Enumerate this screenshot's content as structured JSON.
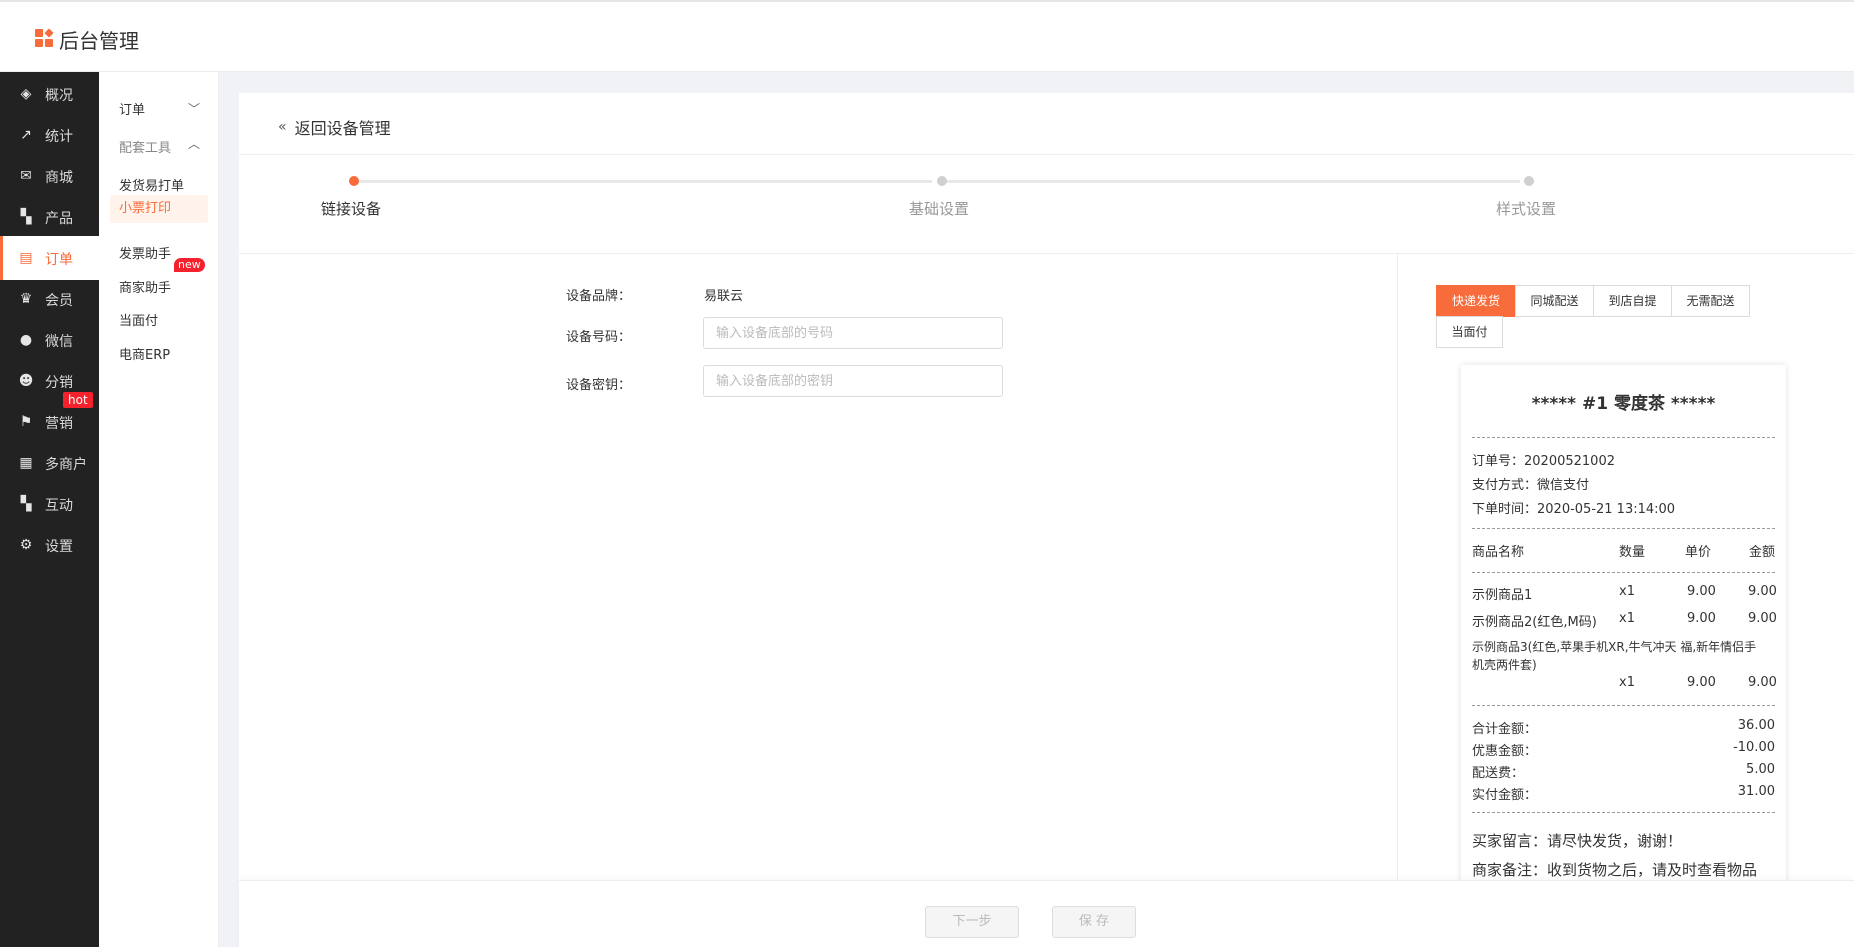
{
  "header": {
    "title": "后台管理"
  },
  "sidebar": {
    "items": [
      {
        "label": "概况",
        "icon": "layers-icon"
      },
      {
        "label": "统计",
        "icon": "chart-icon"
      },
      {
        "label": "商城",
        "icon": "mail-icon"
      },
      {
        "label": "产品",
        "icon": "grid-icon"
      },
      {
        "label": "订单",
        "icon": "clipboard-icon",
        "active": true
      },
      {
        "label": "会员",
        "icon": "crown-icon"
      },
      {
        "label": "微信",
        "icon": "wechat-icon"
      },
      {
        "label": "分销",
        "icon": "user-share-icon"
      },
      {
        "label": "营销",
        "icon": "flag-icon",
        "badge": "hot"
      },
      {
        "label": "多商户",
        "icon": "store-icon"
      },
      {
        "label": "互动",
        "icon": "people-icon"
      },
      {
        "label": "设置",
        "icon": "gear-icon"
      }
    ]
  },
  "subnav": {
    "groups": [
      {
        "label": "订单",
        "chevron": "down"
      },
      {
        "label": "配套工具",
        "chevron": "up"
      }
    ],
    "items": [
      {
        "label": "发货易打单"
      },
      {
        "label": "小票打印",
        "active": true
      },
      {
        "label": "发票助手",
        "badge": "new"
      },
      {
        "label": "商家助手"
      },
      {
        "label": "当面付"
      },
      {
        "label": "电商ERP"
      }
    ]
  },
  "page": {
    "back_label": "返回设备管理",
    "steps": [
      {
        "label": "链接设备",
        "active": true
      },
      {
        "label": "基础设置",
        "active": false
      },
      {
        "label": "样式设置",
        "active": false
      }
    ],
    "form": {
      "brand_label": "设备品牌：",
      "brand_value": "易联云",
      "number_label": "设备号码：",
      "number_placeholder": "输入设备底部的号码",
      "key_label": "设备密钥：",
      "key_placeholder": "输入设备底部的密钥"
    },
    "tabs": [
      "快递发货",
      "同城配送",
      "到店自提",
      "无需配送",
      "当面付"
    ],
    "active_tab": 0,
    "receipt": {
      "title": "***** #1  零度茶 *****",
      "order_no": "订单号：20200521002",
      "pay_method": "支付方式：微信支付",
      "order_time": "下单时间：2020-05-21 13:14:00",
      "columns": [
        "商品名称",
        "数量",
        "单价",
        "金额"
      ],
      "items": [
        {
          "name": "示例商品1",
          "qty": "x1",
          "price": "9.00",
          "amount": "9.00"
        },
        {
          "name": "示例商品2(红色,M码)",
          "qty": "x1",
          "price": "9.00",
          "amount": "9.00"
        },
        {
          "name": "示例商品3(红色,苹果手机XR,牛气冲天 福,新年情侣手",
          "name2": "机壳两件套)",
          "qty": "x1",
          "price": "9.00",
          "amount": "9.00"
        }
      ],
      "totals": [
        {
          "label": "合计金额：",
          "value": "36.00"
        },
        {
          "label": "优惠金额：",
          "value": "-10.00"
        },
        {
          "label": "配送费：",
          "value": "5.00"
        },
        {
          "label": "实付金额：",
          "value": "31.00"
        }
      ],
      "buyer_note": "买家留言：请尽快发货，谢谢！",
      "seller_note": "商家备注：收到货物之后，请及时查看物品"
    },
    "footer": {
      "next_label": "下一步",
      "save_label": "保 存"
    }
  },
  "colors": {
    "accent": "#f86b3a",
    "sidebar_bg": "#222222",
    "content_bg": "#f0f2f5"
  }
}
